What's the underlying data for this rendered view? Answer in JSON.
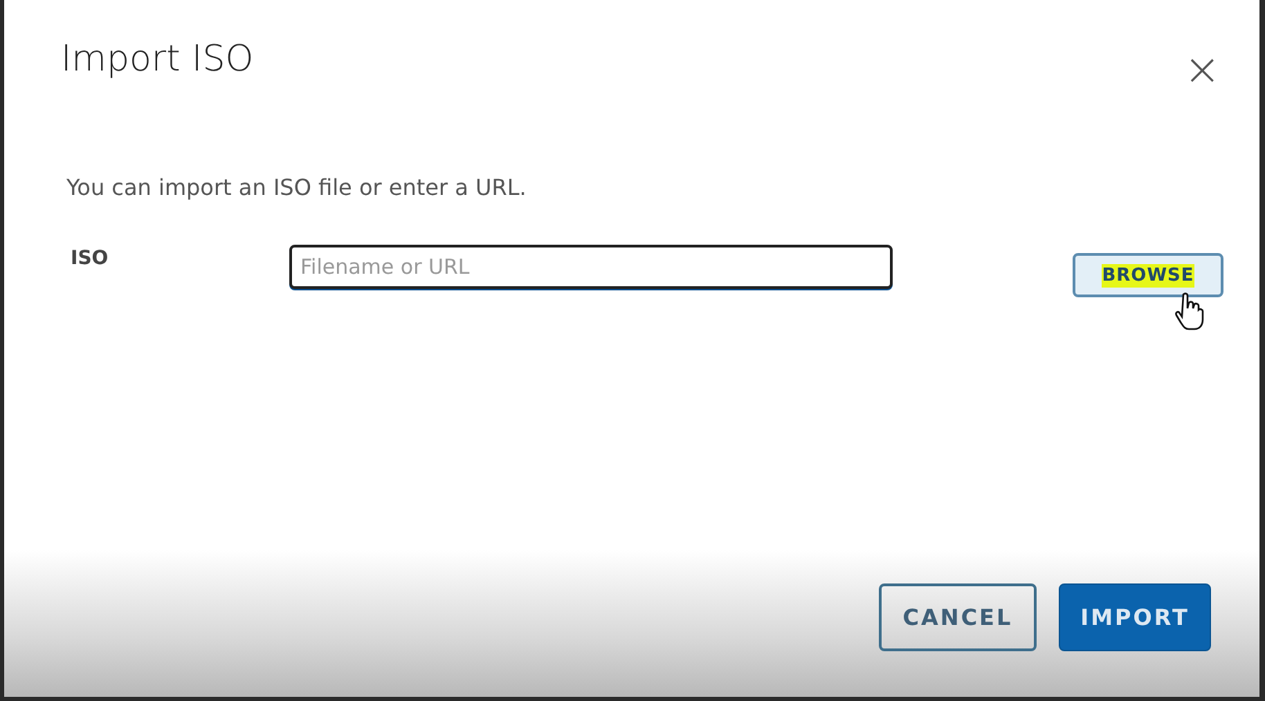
{
  "dialog": {
    "title": "Import ISO",
    "close": "×",
    "description": "You can import an ISO file or enter a URL.",
    "field": {
      "label": "ISO",
      "placeholder": "Filename or URL",
      "focused": true
    },
    "browse_button": {
      "label": "BROWSE",
      "highlighted": true
    },
    "buttons": [
      {
        "label": "CANCEL",
        "kind": "outline"
      },
      {
        "label": "IMPORT",
        "kind": "primary"
      }
    ]
  }
}
